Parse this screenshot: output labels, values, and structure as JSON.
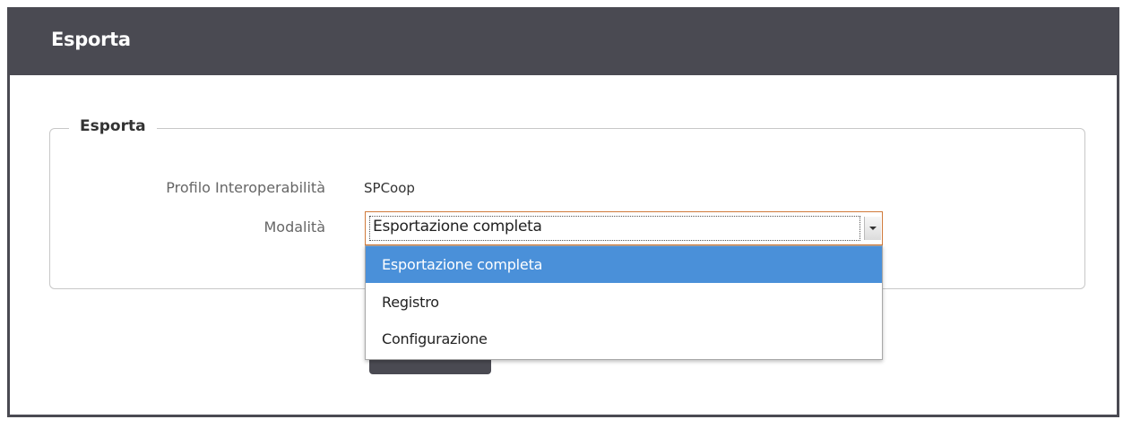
{
  "header": {
    "title": "Esporta"
  },
  "fieldset": {
    "legend": "Esporta"
  },
  "form": {
    "profilo_label": "Profilo Interoperabilità",
    "profilo_value": "SPCoop",
    "modalita_label": "Modalità",
    "modalita_selected": "Esportazione completa"
  },
  "dropdown": {
    "options": [
      "Esportazione completa",
      "Registro",
      "Configurazione"
    ],
    "highlighted_index": 0
  },
  "colors": {
    "header_bg": "#4a4a52",
    "highlight": "#4a90d9",
    "focus_border": "#d07a3a"
  }
}
